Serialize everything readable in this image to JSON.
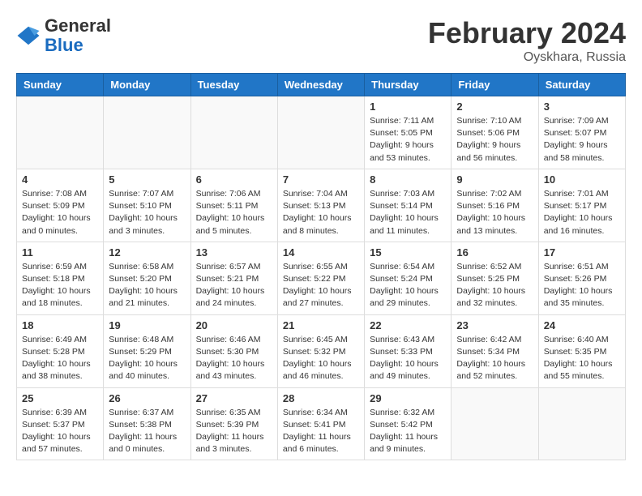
{
  "header": {
    "logo_line1": "General",
    "logo_line2": "Blue",
    "month": "February 2024",
    "location": "Oyskhara, Russia"
  },
  "weekdays": [
    "Sunday",
    "Monday",
    "Tuesday",
    "Wednesday",
    "Thursday",
    "Friday",
    "Saturday"
  ],
  "weeks": [
    [
      {
        "day": "",
        "info": ""
      },
      {
        "day": "",
        "info": ""
      },
      {
        "day": "",
        "info": ""
      },
      {
        "day": "",
        "info": ""
      },
      {
        "day": "1",
        "info": "Sunrise: 7:11 AM\nSunset: 5:05 PM\nDaylight: 9 hours\nand 53 minutes."
      },
      {
        "day": "2",
        "info": "Sunrise: 7:10 AM\nSunset: 5:06 PM\nDaylight: 9 hours\nand 56 minutes."
      },
      {
        "day": "3",
        "info": "Sunrise: 7:09 AM\nSunset: 5:07 PM\nDaylight: 9 hours\nand 58 minutes."
      }
    ],
    [
      {
        "day": "4",
        "info": "Sunrise: 7:08 AM\nSunset: 5:09 PM\nDaylight: 10 hours\nand 0 minutes."
      },
      {
        "day": "5",
        "info": "Sunrise: 7:07 AM\nSunset: 5:10 PM\nDaylight: 10 hours\nand 3 minutes."
      },
      {
        "day": "6",
        "info": "Sunrise: 7:06 AM\nSunset: 5:11 PM\nDaylight: 10 hours\nand 5 minutes."
      },
      {
        "day": "7",
        "info": "Sunrise: 7:04 AM\nSunset: 5:13 PM\nDaylight: 10 hours\nand 8 minutes."
      },
      {
        "day": "8",
        "info": "Sunrise: 7:03 AM\nSunset: 5:14 PM\nDaylight: 10 hours\nand 11 minutes."
      },
      {
        "day": "9",
        "info": "Sunrise: 7:02 AM\nSunset: 5:16 PM\nDaylight: 10 hours\nand 13 minutes."
      },
      {
        "day": "10",
        "info": "Sunrise: 7:01 AM\nSunset: 5:17 PM\nDaylight: 10 hours\nand 16 minutes."
      }
    ],
    [
      {
        "day": "11",
        "info": "Sunrise: 6:59 AM\nSunset: 5:18 PM\nDaylight: 10 hours\nand 18 minutes."
      },
      {
        "day": "12",
        "info": "Sunrise: 6:58 AM\nSunset: 5:20 PM\nDaylight: 10 hours\nand 21 minutes."
      },
      {
        "day": "13",
        "info": "Sunrise: 6:57 AM\nSunset: 5:21 PM\nDaylight: 10 hours\nand 24 minutes."
      },
      {
        "day": "14",
        "info": "Sunrise: 6:55 AM\nSunset: 5:22 PM\nDaylight: 10 hours\nand 27 minutes."
      },
      {
        "day": "15",
        "info": "Sunrise: 6:54 AM\nSunset: 5:24 PM\nDaylight: 10 hours\nand 29 minutes."
      },
      {
        "day": "16",
        "info": "Sunrise: 6:52 AM\nSunset: 5:25 PM\nDaylight: 10 hours\nand 32 minutes."
      },
      {
        "day": "17",
        "info": "Sunrise: 6:51 AM\nSunset: 5:26 PM\nDaylight: 10 hours\nand 35 minutes."
      }
    ],
    [
      {
        "day": "18",
        "info": "Sunrise: 6:49 AM\nSunset: 5:28 PM\nDaylight: 10 hours\nand 38 minutes."
      },
      {
        "day": "19",
        "info": "Sunrise: 6:48 AM\nSunset: 5:29 PM\nDaylight: 10 hours\nand 40 minutes."
      },
      {
        "day": "20",
        "info": "Sunrise: 6:46 AM\nSunset: 5:30 PM\nDaylight: 10 hours\nand 43 minutes."
      },
      {
        "day": "21",
        "info": "Sunrise: 6:45 AM\nSunset: 5:32 PM\nDaylight: 10 hours\nand 46 minutes."
      },
      {
        "day": "22",
        "info": "Sunrise: 6:43 AM\nSunset: 5:33 PM\nDaylight: 10 hours\nand 49 minutes."
      },
      {
        "day": "23",
        "info": "Sunrise: 6:42 AM\nSunset: 5:34 PM\nDaylight: 10 hours\nand 52 minutes."
      },
      {
        "day": "24",
        "info": "Sunrise: 6:40 AM\nSunset: 5:35 PM\nDaylight: 10 hours\nand 55 minutes."
      }
    ],
    [
      {
        "day": "25",
        "info": "Sunrise: 6:39 AM\nSunset: 5:37 PM\nDaylight: 10 hours\nand 57 minutes."
      },
      {
        "day": "26",
        "info": "Sunrise: 6:37 AM\nSunset: 5:38 PM\nDaylight: 11 hours\nand 0 minutes."
      },
      {
        "day": "27",
        "info": "Sunrise: 6:35 AM\nSunset: 5:39 PM\nDaylight: 11 hours\nand 3 minutes."
      },
      {
        "day": "28",
        "info": "Sunrise: 6:34 AM\nSunset: 5:41 PM\nDaylight: 11 hours\nand 6 minutes."
      },
      {
        "day": "29",
        "info": "Sunrise: 6:32 AM\nSunset: 5:42 PM\nDaylight: 11 hours\nand 9 minutes."
      },
      {
        "day": "",
        "info": ""
      },
      {
        "day": "",
        "info": ""
      }
    ]
  ]
}
